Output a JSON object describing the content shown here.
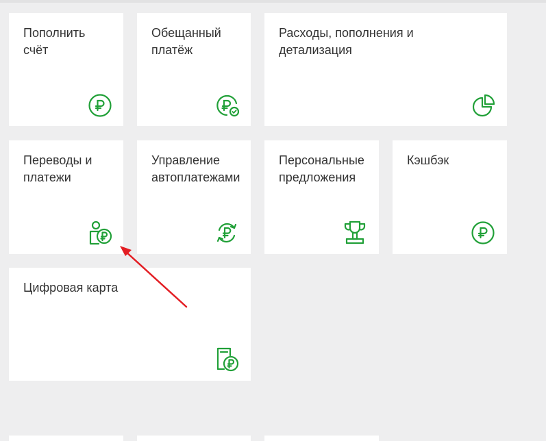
{
  "accent_color": "#21a038",
  "annotation_color": "#e31e24",
  "tiles": [
    {
      "label": "Пополнить\nсчёт",
      "icon": "ruble-circle-icon"
    },
    {
      "label": "Обещанный\nплатёж",
      "icon": "ruble-check-icon"
    },
    {
      "label": "Расходы, пополнения и\nдетализация",
      "icon": "pie-chart-icon"
    },
    {
      "label": "Переводы и\nплатежи",
      "icon": "person-ruble-icon"
    },
    {
      "label": "Управление\nавтоплатежами",
      "icon": "ruble-cycle-icon"
    },
    {
      "label": "Персональные\nпредложения",
      "icon": "trophy-icon"
    },
    {
      "label": "Кэшбэк",
      "icon": "ruble-circle-icon"
    },
    {
      "label": "Цифровая карта",
      "icon": "card-ruble-icon"
    }
  ]
}
